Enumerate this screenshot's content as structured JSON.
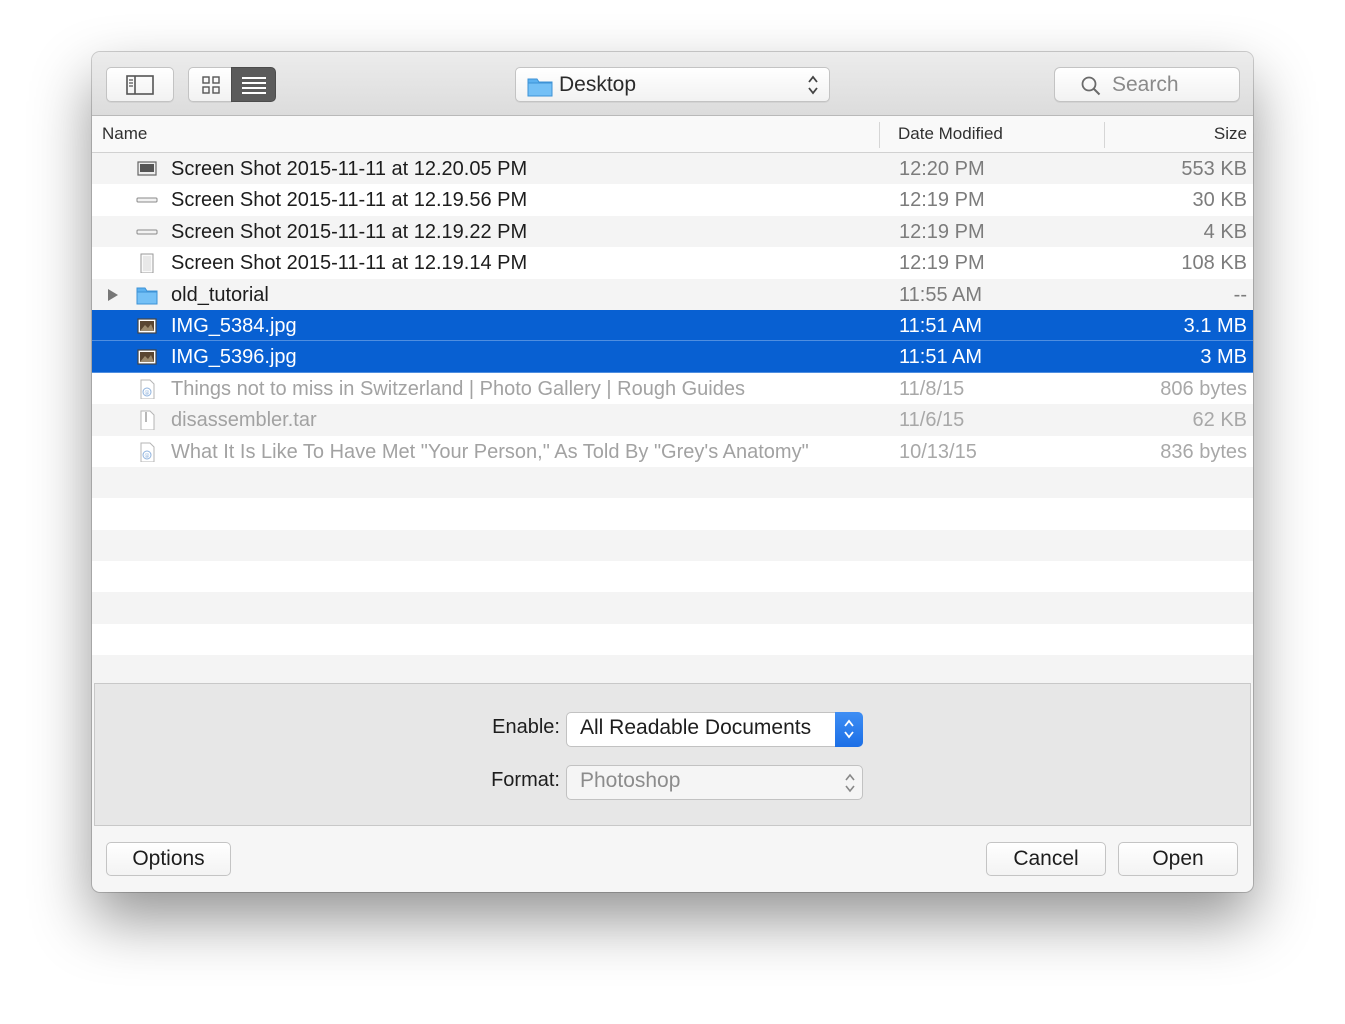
{
  "toolbar": {
    "location": "Desktop",
    "search_placeholder": "Search"
  },
  "columns": {
    "name": "Name",
    "date_modified": "Date Modified",
    "size": "Size"
  },
  "files": [
    {
      "name": "Screen Shot 2015-11-11 at 12.20.05 PM",
      "date": "12:20 PM",
      "size": "553 KB",
      "icon": "screenshot-icon",
      "selected": false,
      "dimmed": false
    },
    {
      "name": "Screen Shot 2015-11-11 at 12.19.56 PM",
      "date": "12:19 PM",
      "size": "30 KB",
      "icon": "screenshot-strip-icon",
      "selected": false,
      "dimmed": false
    },
    {
      "name": "Screen Shot 2015-11-11 at 12.19.22 PM",
      "date": "12:19 PM",
      "size": "4 KB",
      "icon": "screenshot-strip-icon",
      "selected": false,
      "dimmed": false
    },
    {
      "name": "Screen Shot 2015-11-11 at 12.19.14 PM",
      "date": "12:19 PM",
      "size": "108 KB",
      "icon": "screenshot-tall-icon",
      "selected": false,
      "dimmed": false
    },
    {
      "name": "old_tutorial",
      "date": "11:55 AM",
      "size": "--",
      "icon": "folder-icon",
      "selected": false,
      "dimmed": false
    },
    {
      "name": "IMG_5384.jpg",
      "date": "11:51 AM",
      "size": "3.1 MB",
      "icon": "image-icon",
      "selected": true,
      "dimmed": false
    },
    {
      "name": "IMG_5396.jpg",
      "date": "11:51 AM",
      "size": "3 MB",
      "icon": "image-icon",
      "selected": true,
      "dimmed": false
    },
    {
      "name": "Things not to miss in Switzerland | Photo Gallery | Rough Guides",
      "date": "11/8/15",
      "size": "806 bytes",
      "icon": "webloc-icon",
      "selected": false,
      "dimmed": true
    },
    {
      "name": "disassembler.tar",
      "date": "11/6/15",
      "size": "62 KB",
      "icon": "archive-icon",
      "selected": false,
      "dimmed": true
    },
    {
      "name": "What It Is Like To Have Met \"Your Person,\" As Told By \"Grey's Anatomy\"",
      "date": "10/13/15",
      "size": "836 bytes",
      "icon": "webloc-icon",
      "selected": false,
      "dimmed": true
    }
  ],
  "accessory": {
    "enable_label": "Enable:",
    "enable_value": "All Readable Documents",
    "format_label": "Format:",
    "format_value": "Photoshop"
  },
  "buttons": {
    "options": "Options",
    "cancel": "Cancel",
    "open": "Open"
  },
  "colors": {
    "selection": "#0860d2",
    "stepper": "#1c6fe6",
    "folder": "#5cb1f0"
  }
}
